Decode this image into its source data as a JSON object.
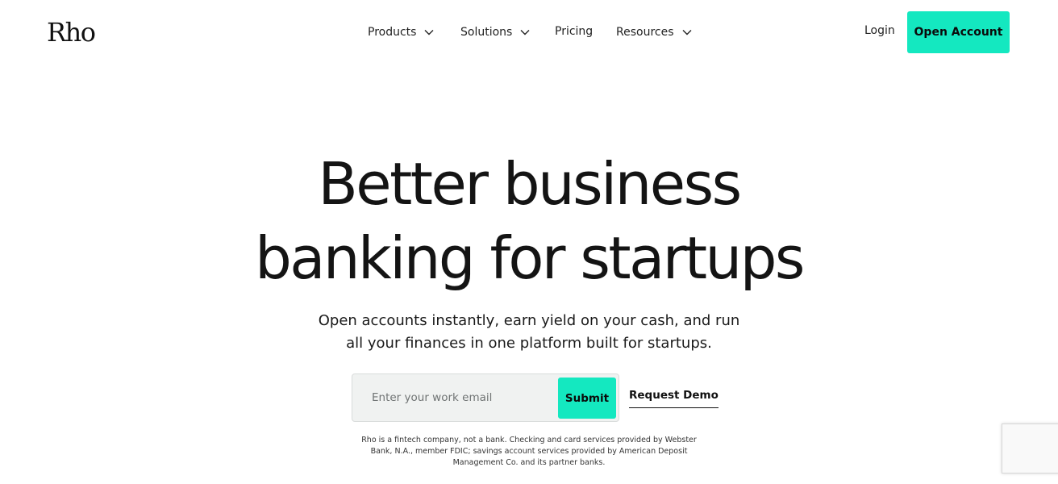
{
  "brand": {
    "logo_text": "Rho"
  },
  "nav": {
    "items": [
      {
        "label": "Products",
        "has_dropdown": true
      },
      {
        "label": "Solutions",
        "has_dropdown": true
      },
      {
        "label": "Pricing",
        "has_dropdown": false
      },
      {
        "label": "Resources",
        "has_dropdown": true
      }
    ],
    "login_label": "Login",
    "cta_label": "Open Account"
  },
  "hero": {
    "headline_line1": "Better business",
    "headline_line2": "banking for startups",
    "sub_line1": "Open accounts instantly, earn yield on your cash, and run",
    "sub_line2": "all your finances in one platform built for startups."
  },
  "signup": {
    "email_placeholder": "Enter your work email",
    "submit_label": "Submit",
    "demo_label": "Request Demo"
  },
  "disclaimer": {
    "line1": "Rho is a fintech company, not a bank. Checking and card services provided by Webster",
    "line2": "Bank, N.A., member FDIC; savings account services provided by American Deposit",
    "line3": "Management Co. and its partner banks."
  },
  "colors": {
    "accent": "#14e8c0",
    "text": "#141414",
    "input_bg": "#f0f2f1"
  },
  "icons": [
    "chevron-down-icon"
  ]
}
